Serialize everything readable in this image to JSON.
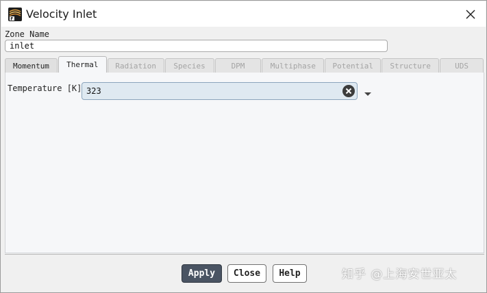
{
  "window": {
    "title": "Velocity Inlet"
  },
  "zone": {
    "label": "Zone Name",
    "value": "inlet"
  },
  "tabs": [
    {
      "label": "Momentum",
      "state": "enabled"
    },
    {
      "label": "Thermal",
      "state": "active"
    },
    {
      "label": "Radiation",
      "state": "disabled"
    },
    {
      "label": "Species",
      "state": "disabled"
    },
    {
      "label": "DPM",
      "state": "disabled"
    },
    {
      "label": "Multiphase",
      "state": "disabled"
    },
    {
      "label": "Potential",
      "state": "disabled"
    },
    {
      "label": "Structure",
      "state": "disabled"
    },
    {
      "label": "UDS",
      "state": "disabled"
    }
  ],
  "thermal": {
    "temperature_label": "Temperature [K]",
    "temperature_value": "323"
  },
  "buttons": {
    "apply": "Apply",
    "close": "Close",
    "help": "Help"
  },
  "watermark": {
    "text": "知乎 @上海安世亚太"
  },
  "icons": {
    "app": "fluent-app-icon",
    "close": "close-icon",
    "clear": "clear-circle-icon",
    "dropdown": "chevron-down-icon"
  },
  "colors": {
    "primary_button": "#4a5463",
    "field_fill": "#dfe9f1",
    "disabled_tab_text": "#a4a4a4"
  }
}
